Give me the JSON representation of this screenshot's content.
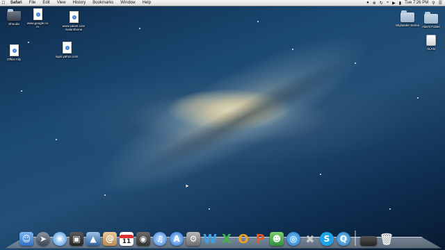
{
  "menubar": {
    "app_name": "Safari",
    "menus": [
      "File",
      "Edit",
      "View",
      "History",
      "Bookmarks",
      "Window",
      "Help"
    ],
    "clock": "Tue 7:26 PM"
  },
  "desktop_icons": {
    "shouda": "Shouda",
    "google": "www.google.co\nm",
    "valant": "www.valant.com\n/valanthome",
    "office_ally": "Office Ally",
    "yahoo": "login.yahoo.com",
    "skylander": "Skylander Series",
    "alans_folder": "Alan's Folder",
    "alan_drive": "ALAN"
  },
  "dock": {
    "calendar_day": "11"
  }
}
